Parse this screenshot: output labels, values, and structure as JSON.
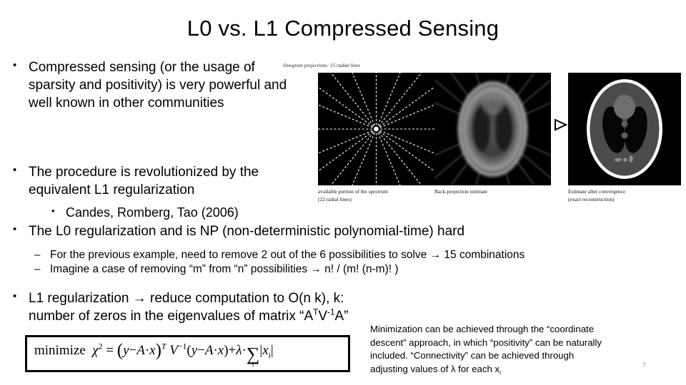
{
  "slide": {
    "title": "L0 vs. L1 Compressed Sensing",
    "page_number": "7",
    "bullet_marker": "•",
    "dash_marker": "–"
  },
  "bullets": {
    "b1": "Compressed sensing (or the usage of sparsity and positivity) is very powerful and well known in other communities",
    "b2": "The procedure is revolutionized by the equivalent L1 regularization",
    "b3": "Candes, Romberg, Tao (2006)",
    "b4": "The L0 regularization and is NP (non-deterministic polynomial-time) hard",
    "b5": "For the previous example, need to remove 2 out of the 6 possibilities to solve → 15 combinations",
    "b6": "Imagine a case of removing “m” from “n” possibilities → n! / (m! (n-m)! )",
    "b7_line1": "L1 regularization → reduce computation to O(n k), k: number of zeros in the",
    "b7_line2_pre": "eigenvalues of  matrix “A",
    "b7_sup1": "T",
    "b7_mid": "V",
    "b7_sup2": "-1",
    "b7_line2_post": "A”"
  },
  "figure": {
    "caption_top": "Sinogram projections: 15 radial lines",
    "panel1_caption_line1": "available portion of the spectrum",
    "panel1_caption_line2": "(22 radial lines)",
    "panel2_caption_line1": "Back-projection estimate",
    "panel2_caption_line2": "",
    "panel3_caption_line1": "Estimate after convergence",
    "panel3_caption_line2": "(exact reconstruction)",
    "arrow_glyph": "▷"
  },
  "equation": {
    "minimize_label": "minimize",
    "chi": "χ",
    "chi_exp": "2",
    "equals": "=",
    "open_paren": "(",
    "y1": "y",
    "minus1": "−",
    "A1": "A",
    "dot1": "·",
    "x1": "x",
    "close_paren": ")",
    "transpose": "T",
    "V": "V",
    "V_exp": "−1",
    "open_paren2": "(",
    "y2": "y",
    "minus2": "−",
    "A2": "A",
    "dot2": "·",
    "x2": "x",
    "close_paren2": ")",
    "plus": "+",
    "lambda": "λ",
    "dot3": "·",
    "sigma": "∑",
    "sigma_index": "i",
    "abs_open": "|",
    "xi": "x",
    "xi_sub": "i",
    "abs_close": "|"
  },
  "note": {
    "line1": "Minimization can be achieved through the “coordinate",
    "line2": "descent” approach, in which “positivity” can be naturally",
    "line3": "included. “Connectivity” can be achieved through",
    "line4_pre": "adjusting values of λ for each x",
    "line4_sub": "i"
  },
  "colors": {
    "background": "#ffffff",
    "text": "#000000",
    "panel_background": "#000000",
    "page_number": "#9a9a9a",
    "equation_border": "#000000"
  }
}
